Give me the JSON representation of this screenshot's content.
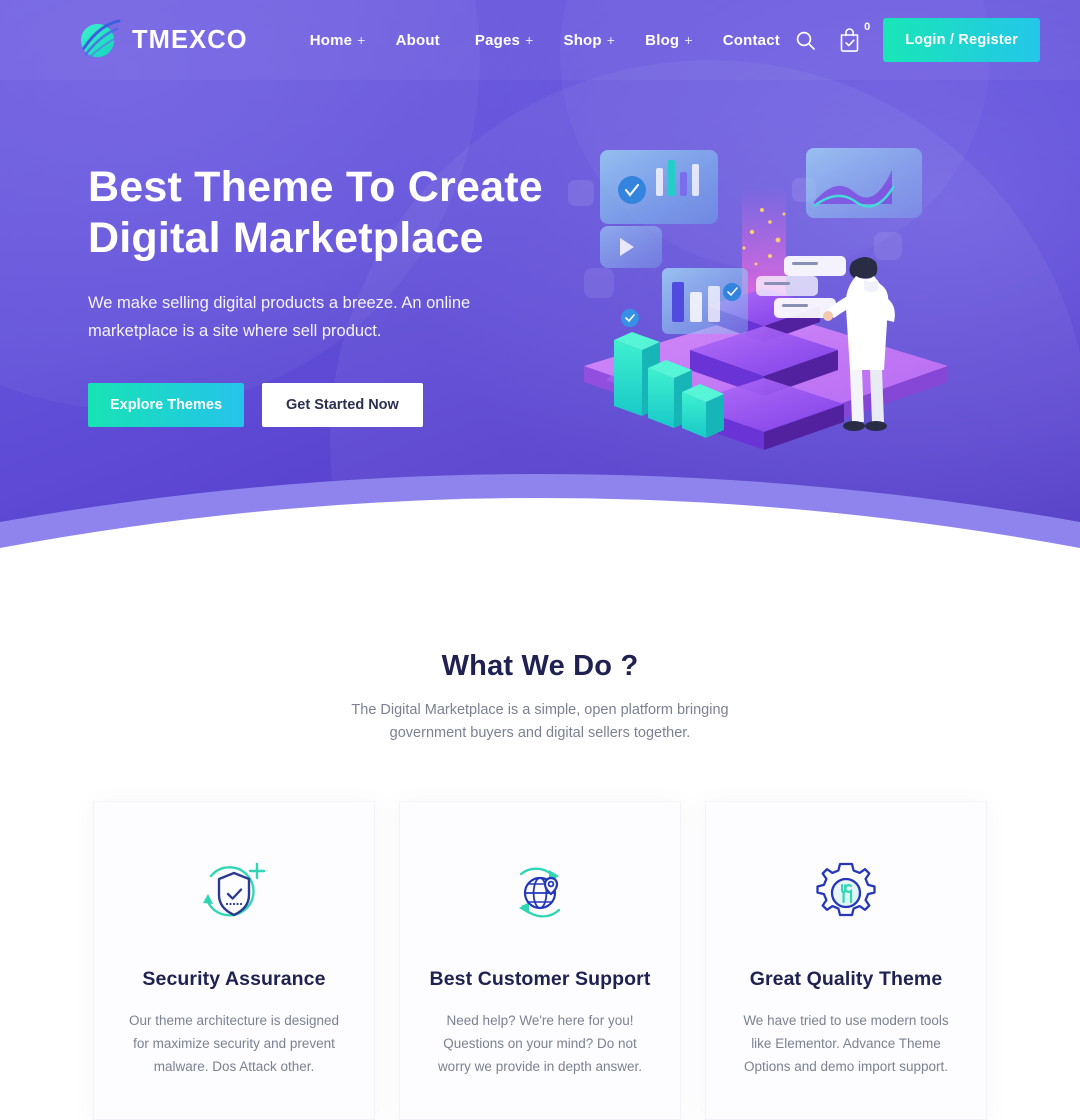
{
  "site": {
    "brand": "TMEXCO",
    "logo_icon": "leaf-circle-logo-icon"
  },
  "header": {
    "nav": [
      {
        "label": "Home",
        "has_dropdown": true,
        "plus": "+"
      },
      {
        "label": "About",
        "has_dropdown": false,
        "plus": ""
      },
      {
        "label": "Pages",
        "has_dropdown": true,
        "plus": "+"
      },
      {
        "label": "Shop",
        "has_dropdown": true,
        "plus": "+"
      },
      {
        "label": "Blog",
        "has_dropdown": true,
        "plus": "+"
      },
      {
        "label": "Contact",
        "has_dropdown": false,
        "plus": ""
      }
    ],
    "search_icon": "search-icon",
    "cart_icon": "shopping-bag-check-icon",
    "cart_count": "0",
    "login_label": "Login / Register"
  },
  "hero": {
    "title_line1": "Best Theme To Create",
    "title_line2": "Digital Marketplace",
    "subtitle": "We make selling digital products a breeze. An online marketplace is a site where sell product.",
    "primary_button": "Explore Themes",
    "secondary_button": "Get Started Now",
    "illustration": "isometric-data-server-platform-illustration"
  },
  "what_we_do": {
    "title": "What We Do ?",
    "subtitle": "The Digital Marketplace is a simple, open platform bringing government buyers and digital sellers together.",
    "cards": [
      {
        "icon": "shield-check-refresh-icon",
        "title": "Security Assurance",
        "desc": "Our theme architecture is designed for maximize security and prevent malware. Dos Attack other."
      },
      {
        "icon": "globe-pin-refresh-icon",
        "title": "Best Customer Support",
        "desc": "Need help? We're here for you! Questions on your mind? Do not worry we provide in depth answer."
      },
      {
        "icon": "gear-tools-icon",
        "title": "Great Quality Theme",
        "desc": "We have tried to use modern tools like Elementor. Advance Theme Options and demo import support."
      }
    ]
  },
  "colors": {
    "purple_primary": "#6858dc",
    "purple_deep": "#4a32c0",
    "teal_accent": "#19e6b6",
    "cyan_accent": "#24c6e8",
    "navy_text": "#1f2250",
    "muted_text": "#7c8192"
  }
}
